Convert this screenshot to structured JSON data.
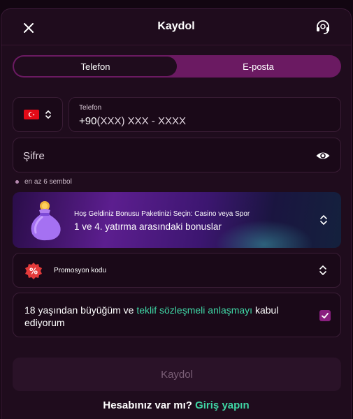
{
  "header": {
    "title": "Kaydol",
    "close_icon": "close-icon",
    "support_icon": "headset-icon"
  },
  "tabs": [
    {
      "label": "Telefon",
      "active": true
    },
    {
      "label": "E-posta",
      "active": false
    }
  ],
  "phone": {
    "country_flag": "turkey-flag-icon",
    "label": "Telefon",
    "prefix": "+90",
    "placeholder": "(XXX) XXX - XXXX"
  },
  "password": {
    "placeholder": "Şifre",
    "toggle_icon": "eye-icon"
  },
  "password_hint": "en az 6 sembol",
  "bonus": {
    "title": "Hoş Geldiniz Bonusu Paketinizi Seçin: Casino veya Spor",
    "subtitle": "1 ve 4. yatırma arasındaki bonuslar"
  },
  "promo": {
    "label": "Promosyon kodu",
    "badge_icon": "percent-badge-icon"
  },
  "terms": {
    "text_before": "18 yaşından büyüğüm ve ",
    "link": "teklif sözleşmeli anlaşmayı",
    "text_after": " kabul ediyorum",
    "checked": true
  },
  "submit_label": "Kaydol",
  "footer": {
    "question": "Hesabınız var mı?",
    "login_link": "Giriş yapın"
  },
  "colors": {
    "accent_purple": "#6b1a62",
    "link_green": "#3fd6a5",
    "background": "#1f0c1d"
  }
}
